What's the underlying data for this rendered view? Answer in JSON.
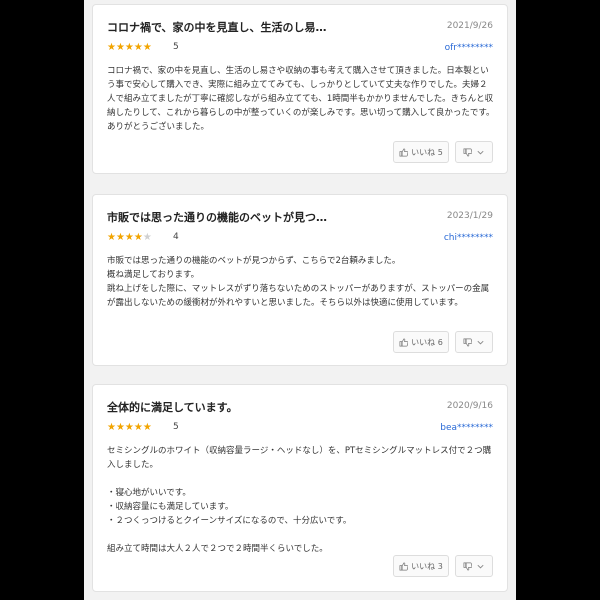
{
  "reviews": [
    {
      "title": "コロナ禍で、家の中を見直し、生活のし易…",
      "date": "2021/9/26",
      "stars": "★★★★★",
      "stars_off": "",
      "rating": "5",
      "user": "ofr********",
      "body": "コロナ禍で、家の中を見直し、生活のし易さや収納の事も考えて購入させて頂きました。日本製という事で安心して購入でき、実際に組み立ててみても、しっかりとしていて丈夫な作りでした。夫婦２人で組み立てましたが丁寧に確認しながら組み立てても、1時間半もかかりませんでした。きちんと収納したりして、これから暮らしの中が整っていくのが楽しみです。思い切って購入して良かったです。ありがとうございました。",
      "helpful_label": "いいね 5"
    },
    {
      "title": "市販では思った通りの機能のベットが見つ…",
      "date": "2023/1/29",
      "stars": "★★★★",
      "stars_off": "★",
      "rating": "4",
      "user": "chi********",
      "body": "市販では思った通りの機能のベットが見つからず、こちらで2台頼みました。\n概ね満足しております。\n跳ね上げをした際に、マットレスがずり落ちないためのストッパーがありますが、ストッパーの金属が露出しないための緩衝材が外れやすいと思いました。そちら以外は快適に使用しています。",
      "helpful_label": "いいね 6"
    },
    {
      "title": "全体的に満足しています。",
      "date": "2020/9/16",
      "stars": "★★★★★",
      "stars_off": "",
      "rating": "5",
      "user": "bea********",
      "body": "セミシングルのホワイト（収納容量ラージ・ヘッドなし）を、PTセミシングルマットレス付で２つ購入しました。\n\n・寝心地がいいです。\n・収納容量にも満足しています。\n・２つくっつけるとクイーンサイズになるので、十分広いです。\n\n組み立て時間は大人２人で２つで２時間半くらいでした。",
      "helpful_label": "いいね 3"
    }
  ],
  "colors": {
    "star": "#f2a400",
    "user_link": "#2a6ad6"
  },
  "icons": {
    "helpful": "thumbs-up-icon",
    "unhelpful": "thumbs-down-icon",
    "menu": "chevron-down-icon"
  }
}
